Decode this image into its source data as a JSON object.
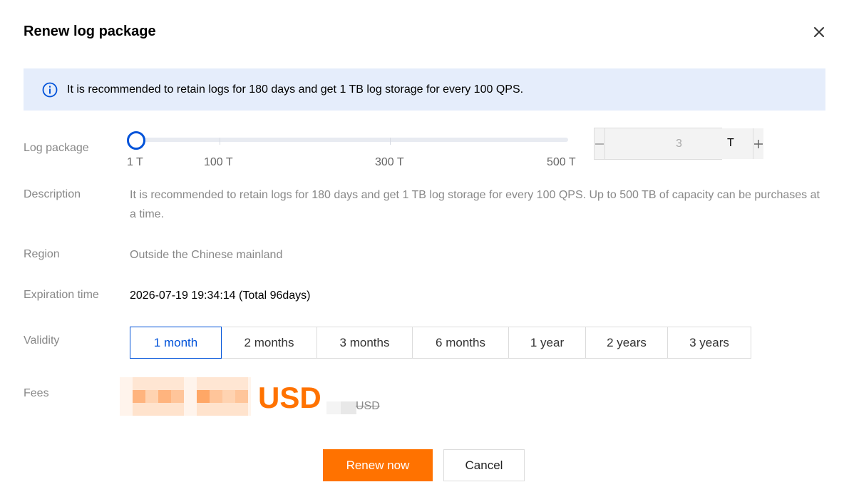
{
  "dialog": {
    "title": "Renew log package",
    "close_icon": "close-icon"
  },
  "notice": {
    "icon": "info-icon",
    "text": "It is recommended to retain logs for 180 days and get 1 TB log storage for every 100 QPS."
  },
  "log_package": {
    "label": "Log package",
    "slider": {
      "min": 1,
      "max": 500,
      "value": 3,
      "tick_labels": [
        "1 T",
        "100 T",
        "300 T",
        "500 T"
      ]
    },
    "stepper": {
      "decrement_icon": "minus-icon",
      "increment_icon": "plus-icon",
      "value": "3",
      "unit": "T"
    }
  },
  "description": {
    "label": "Description",
    "text": "It is recommended to retain logs for 180 days and get 1 TB log storage for every 100 QPS. Up to 500 TB of capacity can be purchases at a time."
  },
  "region": {
    "label": "Region",
    "value": "Outside the Chinese mainland"
  },
  "expiration": {
    "label": "Expiration time",
    "value": "2026-07-19 19:34:14 (Total 96days)"
  },
  "validity": {
    "label": "Validity",
    "options": [
      "1 month",
      "2 months",
      "3 months",
      "6 months",
      "1 year",
      "2 years",
      "3 years"
    ],
    "selected": "1 month"
  },
  "fees": {
    "label": "Fees",
    "currency": "USD",
    "original_currency": "USD"
  },
  "footer": {
    "renew_label": "Renew now",
    "cancel_label": "Cancel"
  },
  "colors": {
    "accent": "#0052d9",
    "price": "#ff7200",
    "notice_bg": "#e5edfb"
  }
}
